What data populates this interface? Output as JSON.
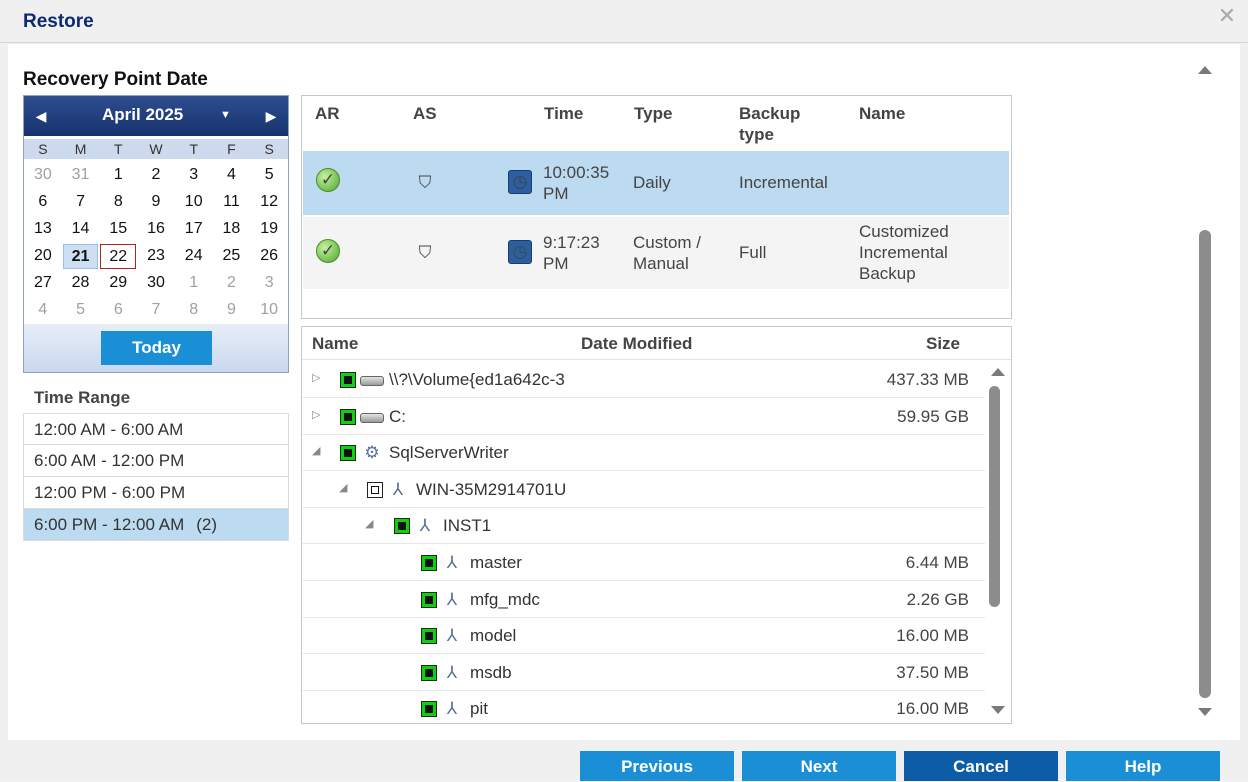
{
  "dialog": {
    "title": "Restore"
  },
  "section_title": "Recovery Point Date",
  "calendar": {
    "month_label": "April 2025",
    "days_of_week": [
      "S",
      "M",
      "T",
      "W",
      "T",
      "F",
      "S"
    ],
    "weeks": [
      [
        "30",
        "31",
        "1",
        "2",
        "3",
        "4",
        "5"
      ],
      [
        "6",
        "7",
        "8",
        "9",
        "10",
        "11",
        "12"
      ],
      [
        "13",
        "14",
        "15",
        "16",
        "17",
        "18",
        "19"
      ],
      [
        "20",
        "21",
        "22",
        "23",
        "24",
        "25",
        "26"
      ],
      [
        "27",
        "28",
        "29",
        "30",
        "1",
        "2",
        "3"
      ],
      [
        "4",
        "5",
        "6",
        "7",
        "8",
        "9",
        "10"
      ]
    ],
    "selected_day": "21",
    "today_day": "22",
    "today_button": "Today"
  },
  "time_range": {
    "label": "Time Range",
    "items": [
      {
        "label": "12:00 AM - 6:00 AM",
        "count": ""
      },
      {
        "label": "6:00 AM - 12:00 PM",
        "count": ""
      },
      {
        "label": "12:00 PM - 6:00 PM",
        "count": ""
      },
      {
        "label": "6:00 PM - 12:00 AM",
        "count": "(2)"
      }
    ]
  },
  "recovery_points": {
    "headers": {
      "ar": "AR",
      "as": "AS",
      "time": "Time",
      "type": "Type",
      "backup_type_1": "Backup",
      "backup_type_2": "type",
      "name": "Name"
    },
    "rows": [
      {
        "time_1": "10:00:35",
        "time_2": "PM",
        "type_1": "Daily",
        "type_2": "",
        "backup_type": "Incremental",
        "name_1": "",
        "name_2": "",
        "name_3": ""
      },
      {
        "time_1": "9:17:23",
        "time_2": "PM",
        "type_1": "Custom /",
        "type_2": "Manual",
        "backup_type": "Full",
        "name_1": "Customized",
        "name_2": "Incremental",
        "name_3": "Backup"
      }
    ]
  },
  "file_tree": {
    "headers": {
      "name": "Name",
      "date_modified": "Date Modified",
      "size": "Size"
    },
    "rows": [
      {
        "name": "\\\\?\\Volume{ed1a642c-3",
        "size": "437.33 MB"
      },
      {
        "name": "C:",
        "size": "59.95 GB"
      },
      {
        "name": "SqlServerWriter",
        "size": ""
      },
      {
        "name": "WIN-35M2914701U",
        "size": ""
      },
      {
        "name": "INST1",
        "size": ""
      },
      {
        "name": "master",
        "size": "6.44 MB"
      },
      {
        "name": "mfg_mdc",
        "size": "2.26 GB"
      },
      {
        "name": "model",
        "size": "16.00 MB"
      },
      {
        "name": "msdb",
        "size": "37.50 MB"
      },
      {
        "name": "pit",
        "size": "16.00 MB"
      }
    ]
  },
  "buttons": {
    "previous": "Previous",
    "next": "Next",
    "cancel": "Cancel",
    "help": "Help"
  },
  "icons": {
    "close": "close-icon",
    "ok": "check-circle-icon",
    "shield": "shield-icon",
    "schedule": "clock-lock-icon",
    "drive": "drive-icon",
    "sql": "sql-writer-icon",
    "database": "database-icon"
  }
}
